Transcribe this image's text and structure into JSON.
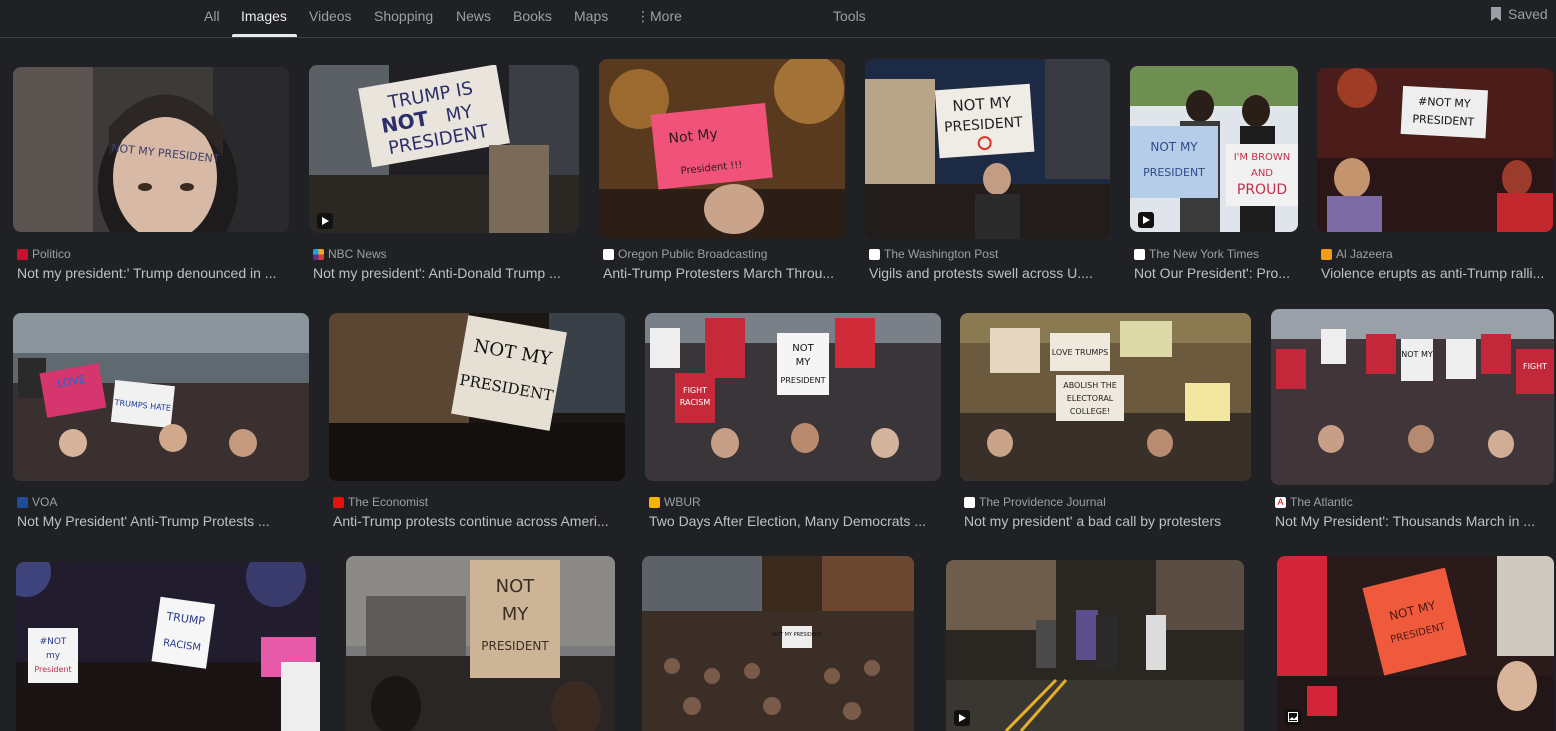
{
  "tabs": [
    {
      "label": "All",
      "active": false
    },
    {
      "label": "Images",
      "active": true
    },
    {
      "label": "Videos",
      "active": false
    },
    {
      "label": "Shopping",
      "active": false
    },
    {
      "label": "News",
      "active": false
    },
    {
      "label": "Books",
      "active": false
    },
    {
      "label": "Maps",
      "active": false
    }
  ],
  "more_label": "More",
  "tools_label": "Tools",
  "saved_label": "Saved",
  "results": [
    {
      "source": "Politico",
      "title": "Not my president:' Trump denounced in ...",
      "favicon_color": "#c8102e",
      "icon": "politico-favicon"
    },
    {
      "source": "NBC News",
      "title": "Not my president': Anti-Donald Trump ...",
      "favicon_color": "#f5a623",
      "icon": "nbc-favicon"
    },
    {
      "source": "Oregon Public Broadcasting",
      "title": "Anti-Trump Protesters March Throu...",
      "favicon_color": "#ffffff",
      "icon": "opb-favicon"
    },
    {
      "source": "The Washington Post",
      "title": "Vigils and protests swell across U....",
      "favicon_color": "#ffffff",
      "icon": "wapo-favicon"
    },
    {
      "source": "The New York Times",
      "title": "Not Our President': Pro...",
      "favicon_color": "#ffffff",
      "icon": "nyt-favicon"
    },
    {
      "source": "Al Jazeera",
      "title": "Violence erupts as anti-Trump ralli...",
      "favicon_color": "#f39c12",
      "icon": "aljazeera-favicon"
    },
    {
      "source": "VOA",
      "title": "Not My President' Anti-Trump Protests ...",
      "favicon_color": "#1f4e9c",
      "icon": "voa-favicon"
    },
    {
      "source": "The Economist",
      "title": "Anti-Trump protests continue across Ameri...",
      "favicon_color": "#e3120b",
      "icon": "economist-favicon"
    },
    {
      "source": "WBUR",
      "title": "Two Days After Election, Many Democrats ...",
      "favicon_color": "#f7b500",
      "icon": "wbur-favicon"
    },
    {
      "source": "The Providence Journal",
      "title": "Not my president' a bad call by protesters",
      "favicon_color": "#ffffff",
      "icon": "projo-favicon"
    },
    {
      "source": "The Atlantic",
      "title": "Not My President': Thousands March in ...",
      "favicon_color": "#ffffff",
      "icon": "atlantic-favicon"
    },
    {
      "source": "",
      "title": "",
      "favicon_color": "",
      "icon": ""
    },
    {
      "source": "",
      "title": "",
      "favicon_color": "",
      "icon": ""
    },
    {
      "source": "",
      "title": "",
      "favicon_color": "",
      "icon": ""
    },
    {
      "source": "",
      "title": "",
      "favicon_color": "",
      "icon": ""
    },
    {
      "source": "",
      "title": "",
      "favicon_color": "",
      "icon": ""
    }
  ],
  "signs": {
    "r0": "NOT MY PRESIDENT",
    "r1a": "TRUMP IS",
    "r1b": "NOT",
    "r1c": "MY",
    "r1d": "PRESIDENT",
    "r2a": "Not My",
    "r2b": "President !!!",
    "r3a": "NOT MY",
    "r3b": "PRESIDENT",
    "r4a": "NOT MY",
    "r4b": "PRESIDENT",
    "r4c": "I'M BROWN",
    "r4d": "AND",
    "r4e": "PROUD",
    "r5a": "#NOT MY",
    "r5b": "PRESIDENT",
    "r6a": "LOVE",
    "r6b": "TRUMPS HATE",
    "r7a": "NOT MY",
    "r7b": "PRESIDENT",
    "r8a": "NOT",
    "r8b": "MY",
    "r8c": "PRESIDENT",
    "r8d": "FIGHT",
    "r8e": "RACISM",
    "r9a": "ABOLISH THE",
    "r9b": "ELECTORAL",
    "r9c": "COLLEGE!",
    "r9d": "LOVE TRUMPS",
    "r10a": "NOT MY",
    "r10b": "FIGHT",
    "r11a": "#NOT",
    "r11b": "my",
    "r11c": "President",
    "r11d": "TRUMP",
    "r11e": "RACISM",
    "r12a": "NOT",
    "r12b": "MY",
    "r12c": "PRESIDENT",
    "r13": "NOT MY PRESIDENT",
    "r15a": "NOT MY",
    "r15b": "PRESIDENT"
  }
}
